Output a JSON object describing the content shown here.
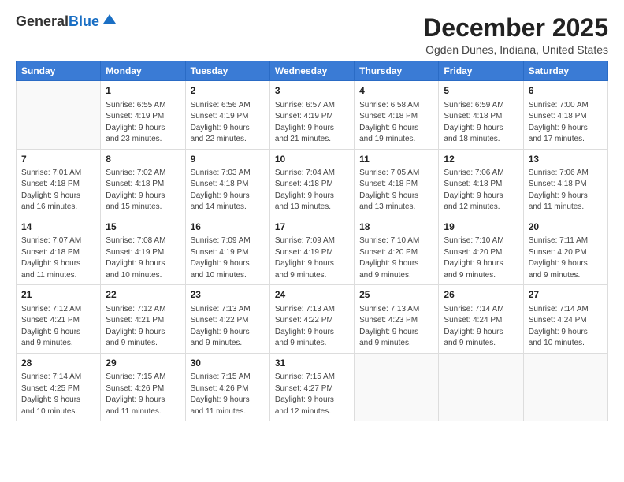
{
  "logo": {
    "general": "General",
    "blue": "Blue"
  },
  "title": "December 2025",
  "location": "Ogden Dunes, Indiana, United States",
  "days_of_week": [
    "Sunday",
    "Monday",
    "Tuesday",
    "Wednesday",
    "Thursday",
    "Friday",
    "Saturday"
  ],
  "weeks": [
    [
      {
        "day": "",
        "info": ""
      },
      {
        "day": "1",
        "info": "Sunrise: 6:55 AM\nSunset: 4:19 PM\nDaylight: 9 hours\nand 23 minutes."
      },
      {
        "day": "2",
        "info": "Sunrise: 6:56 AM\nSunset: 4:19 PM\nDaylight: 9 hours\nand 22 minutes."
      },
      {
        "day": "3",
        "info": "Sunrise: 6:57 AM\nSunset: 4:19 PM\nDaylight: 9 hours\nand 21 minutes."
      },
      {
        "day": "4",
        "info": "Sunrise: 6:58 AM\nSunset: 4:18 PM\nDaylight: 9 hours\nand 19 minutes."
      },
      {
        "day": "5",
        "info": "Sunrise: 6:59 AM\nSunset: 4:18 PM\nDaylight: 9 hours\nand 18 minutes."
      },
      {
        "day": "6",
        "info": "Sunrise: 7:00 AM\nSunset: 4:18 PM\nDaylight: 9 hours\nand 17 minutes."
      }
    ],
    [
      {
        "day": "7",
        "info": "Sunrise: 7:01 AM\nSunset: 4:18 PM\nDaylight: 9 hours\nand 16 minutes."
      },
      {
        "day": "8",
        "info": "Sunrise: 7:02 AM\nSunset: 4:18 PM\nDaylight: 9 hours\nand 15 minutes."
      },
      {
        "day": "9",
        "info": "Sunrise: 7:03 AM\nSunset: 4:18 PM\nDaylight: 9 hours\nand 14 minutes."
      },
      {
        "day": "10",
        "info": "Sunrise: 7:04 AM\nSunset: 4:18 PM\nDaylight: 9 hours\nand 13 minutes."
      },
      {
        "day": "11",
        "info": "Sunrise: 7:05 AM\nSunset: 4:18 PM\nDaylight: 9 hours\nand 13 minutes."
      },
      {
        "day": "12",
        "info": "Sunrise: 7:06 AM\nSunset: 4:18 PM\nDaylight: 9 hours\nand 12 minutes."
      },
      {
        "day": "13",
        "info": "Sunrise: 7:06 AM\nSunset: 4:18 PM\nDaylight: 9 hours\nand 11 minutes."
      }
    ],
    [
      {
        "day": "14",
        "info": "Sunrise: 7:07 AM\nSunset: 4:18 PM\nDaylight: 9 hours\nand 11 minutes."
      },
      {
        "day": "15",
        "info": "Sunrise: 7:08 AM\nSunset: 4:19 PM\nDaylight: 9 hours\nand 10 minutes."
      },
      {
        "day": "16",
        "info": "Sunrise: 7:09 AM\nSunset: 4:19 PM\nDaylight: 9 hours\nand 10 minutes."
      },
      {
        "day": "17",
        "info": "Sunrise: 7:09 AM\nSunset: 4:19 PM\nDaylight: 9 hours\nand 9 minutes."
      },
      {
        "day": "18",
        "info": "Sunrise: 7:10 AM\nSunset: 4:20 PM\nDaylight: 9 hours\nand 9 minutes."
      },
      {
        "day": "19",
        "info": "Sunrise: 7:10 AM\nSunset: 4:20 PM\nDaylight: 9 hours\nand 9 minutes."
      },
      {
        "day": "20",
        "info": "Sunrise: 7:11 AM\nSunset: 4:20 PM\nDaylight: 9 hours\nand 9 minutes."
      }
    ],
    [
      {
        "day": "21",
        "info": "Sunrise: 7:12 AM\nSunset: 4:21 PM\nDaylight: 9 hours\nand 9 minutes."
      },
      {
        "day": "22",
        "info": "Sunrise: 7:12 AM\nSunset: 4:21 PM\nDaylight: 9 hours\nand 9 minutes."
      },
      {
        "day": "23",
        "info": "Sunrise: 7:13 AM\nSunset: 4:22 PM\nDaylight: 9 hours\nand 9 minutes."
      },
      {
        "day": "24",
        "info": "Sunrise: 7:13 AM\nSunset: 4:22 PM\nDaylight: 9 hours\nand 9 minutes."
      },
      {
        "day": "25",
        "info": "Sunrise: 7:13 AM\nSunset: 4:23 PM\nDaylight: 9 hours\nand 9 minutes."
      },
      {
        "day": "26",
        "info": "Sunrise: 7:14 AM\nSunset: 4:24 PM\nDaylight: 9 hours\nand 9 minutes."
      },
      {
        "day": "27",
        "info": "Sunrise: 7:14 AM\nSunset: 4:24 PM\nDaylight: 9 hours\nand 10 minutes."
      }
    ],
    [
      {
        "day": "28",
        "info": "Sunrise: 7:14 AM\nSunset: 4:25 PM\nDaylight: 9 hours\nand 10 minutes."
      },
      {
        "day": "29",
        "info": "Sunrise: 7:15 AM\nSunset: 4:26 PM\nDaylight: 9 hours\nand 11 minutes."
      },
      {
        "day": "30",
        "info": "Sunrise: 7:15 AM\nSunset: 4:26 PM\nDaylight: 9 hours\nand 11 minutes."
      },
      {
        "day": "31",
        "info": "Sunrise: 7:15 AM\nSunset: 4:27 PM\nDaylight: 9 hours\nand 12 minutes."
      },
      {
        "day": "",
        "info": ""
      },
      {
        "day": "",
        "info": ""
      },
      {
        "day": "",
        "info": ""
      }
    ]
  ]
}
